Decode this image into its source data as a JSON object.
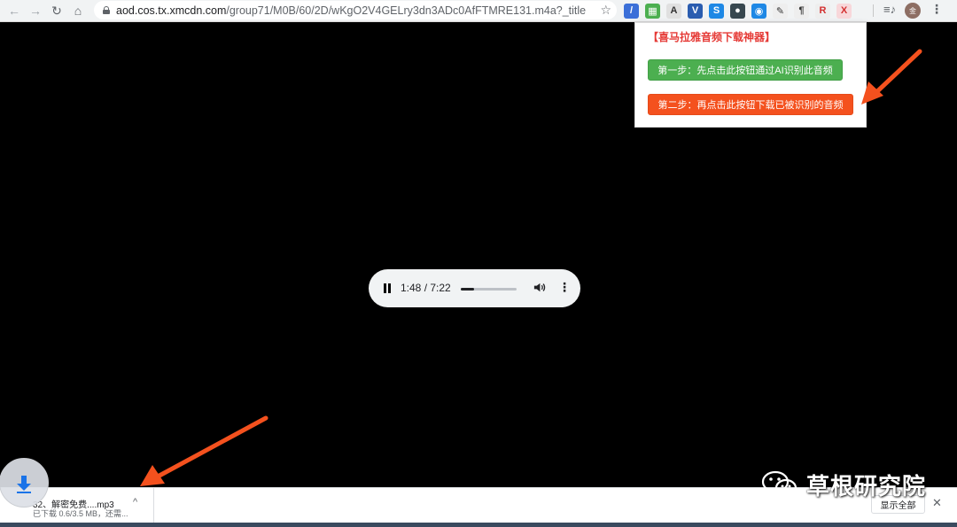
{
  "browser": {
    "url_host": "aod.cos.tx.xmcdn.com",
    "url_path": "/group71/M0B/60/2D/wKgO2V4GELry3dn3ADc0AfFTMRE131.m4a?_title=32...",
    "nav": {
      "back": "←",
      "forward": "→",
      "reload": "↻",
      "home": "⌂"
    },
    "bookmark_icon": "star-icon",
    "extensions": [
      {
        "name": "opera-extension-icon",
        "color": "#3b6fd8",
        "glyph": "/"
      },
      {
        "name": "qr-extension-icon",
        "color": "#4caf50",
        "glyph": "▦"
      },
      {
        "name": "shield-extension-icon",
        "color": "#e0e0e0",
        "glyph": "A"
      },
      {
        "name": "v-extension-icon",
        "color": "#2a5db0",
        "glyph": "V"
      },
      {
        "name": "s-extension-icon",
        "color": "#1e88e5",
        "glyph": "S"
      },
      {
        "name": "bot-extension-icon",
        "color": "#37474f",
        "glyph": "●"
      },
      {
        "name": "ring-extension-icon",
        "color": "#1e88e5",
        "glyph": "◉"
      },
      {
        "name": "pen-extension-icon",
        "color": "#eeeeee",
        "glyph": "✎"
      },
      {
        "name": "paragraph-extension-icon",
        "color": "#eeeeee",
        "glyph": "¶"
      },
      {
        "name": "r-extension-icon",
        "color": "#eeeeee",
        "glyph": "R"
      },
      {
        "name": "x-extension-icon",
        "color": "#f8d7da",
        "glyph": "X"
      }
    ],
    "avatar_text": "金"
  },
  "popup": {
    "title": "【喜马拉雅音频下载神器】",
    "step1": "第一步：先点击此按钮通过AI识别此音频",
    "step2": "第二步：再点击此按钮下载已被识别的音频"
  },
  "player": {
    "current_time": "1:48",
    "separator": " / ",
    "duration": "7:22",
    "progress_fraction": 0.245
  },
  "download": {
    "file_name": "32、解密免费....mp3",
    "status": "已下载 0.6/3.5 MB，还需...",
    "show_all": "显示全部",
    "close": "✕",
    "chevron": "^"
  },
  "watermark": {
    "text": "草根研究院"
  },
  "colors": {
    "popup_title": "#e53935",
    "step1_bg": "#4caf50",
    "step2_bg": "#f4511e",
    "annotation_arrow": "#f4511e"
  }
}
